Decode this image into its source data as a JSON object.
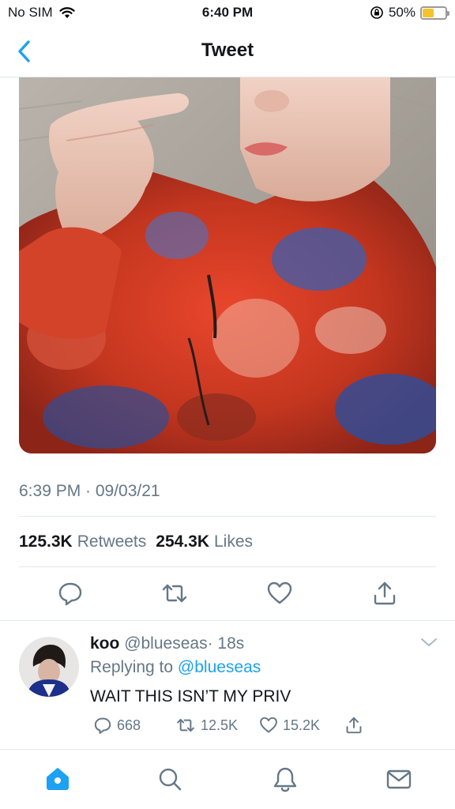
{
  "status_bar": {
    "carrier": "No SIM",
    "time": "6:40 PM",
    "battery_percent": "50%",
    "battery_level": 0.5,
    "battery_color": "#f7c22a"
  },
  "nav": {
    "title": "Tweet",
    "back_icon": "chevron-left-icon"
  },
  "tweet": {
    "timestamp": "6:39 PM · 09/03/21",
    "retweets_count": "125.3K",
    "retweets_label": "Retweets",
    "likes_count": "254.3K",
    "likes_label": "Likes",
    "actions": [
      "reply-icon",
      "retweet-icon",
      "like-icon",
      "share-icon"
    ]
  },
  "reply": {
    "name": "koo",
    "handle": "@blueseas",
    "time": "· 18s",
    "replying_prefix": "Replying to",
    "replying_to": "@blueseas",
    "text": "WAIT THIS ISN’T MY PRIV",
    "reply_count": "668",
    "retweet_count": "12.5K",
    "like_count": "15.2K"
  },
  "tab_bar": {
    "tabs": [
      "home-icon",
      "search-icon",
      "notifications-icon",
      "messages-icon"
    ],
    "active_color": "#1da1f2"
  },
  "colors": {
    "accent": "#1da1f2",
    "secondary_text": "#657786",
    "divider": "#e1e8ed"
  }
}
